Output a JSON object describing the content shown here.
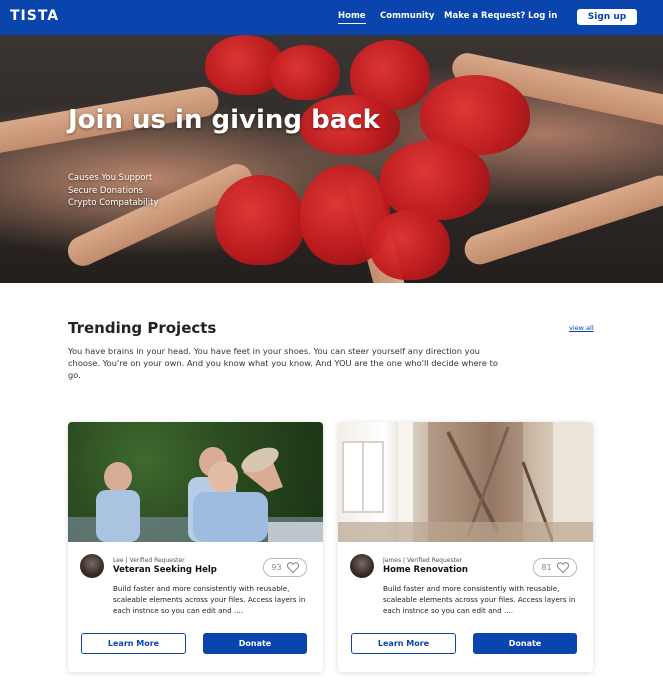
{
  "brand": {
    "logo_text": "TISTA",
    "primary_color": "#0a45ad"
  },
  "nav": {
    "links": [
      {
        "label": "Home",
        "active": true
      },
      {
        "label": "Community",
        "active": false
      },
      {
        "label": "Make a Request?",
        "active": false
      },
      {
        "label": "Log in",
        "active": false
      }
    ],
    "signup_label": "Sign up"
  },
  "hero": {
    "title": "Join us in giving back",
    "features": [
      "Causes You Support",
      "Secure Donations",
      "Crypto Compatability"
    ]
  },
  "trending": {
    "title": "Trending Projects",
    "view_all": "view all",
    "description": "You have brains in your head. You have feet in your shoes. You can steer yourself any direction you choose. You're on your own. And you know what you know. And YOU are the one who'll decide where to go."
  },
  "cards": [
    {
      "poster": "Lee  |  Verified Requester",
      "title": "Veteran Seeking Help",
      "likes": "93",
      "description": "Build faster and more consistently with reusable, scaleable elements across your files. Access layers in each instnce so you can edit and ....",
      "learn_more": "Learn More",
      "donate": "Donate"
    },
    {
      "poster": "James  |  Verified Requester",
      "title": "Home Renovation",
      "likes": "81",
      "description": "Build faster and more consistently with reusable, scaleable elements across your files. Access layers in each instnce so you can edit and ....",
      "learn_more": "Learn More",
      "donate": "Donate"
    }
  ]
}
